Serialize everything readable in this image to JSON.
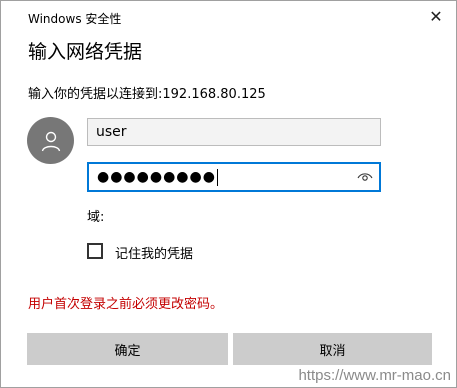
{
  "window": {
    "title": "Windows 安全性",
    "close_symbol": "✕"
  },
  "dialog": {
    "heading": "输入网络凭据",
    "subtitle": "输入你的凭据以连接到:192.168.80.125"
  },
  "form": {
    "avatar_icon": "user-icon",
    "username_value": "user",
    "password_mask": "●●●●●●●●●",
    "reveal_icon": "eye-icon",
    "domain_label": "域:",
    "remember_label": "记住我的凭据",
    "remember_checked": false
  },
  "error_message": "用户首次登录之前必须更改密码。",
  "buttons": {
    "ok_label": "确定",
    "cancel_label": "取消"
  },
  "watermark": "https://www.mr-mao.cn",
  "colors": {
    "accent": "#0078d7",
    "error": "#c40000",
    "button_bg": "#cccccc",
    "avatar_bg": "#777777"
  }
}
